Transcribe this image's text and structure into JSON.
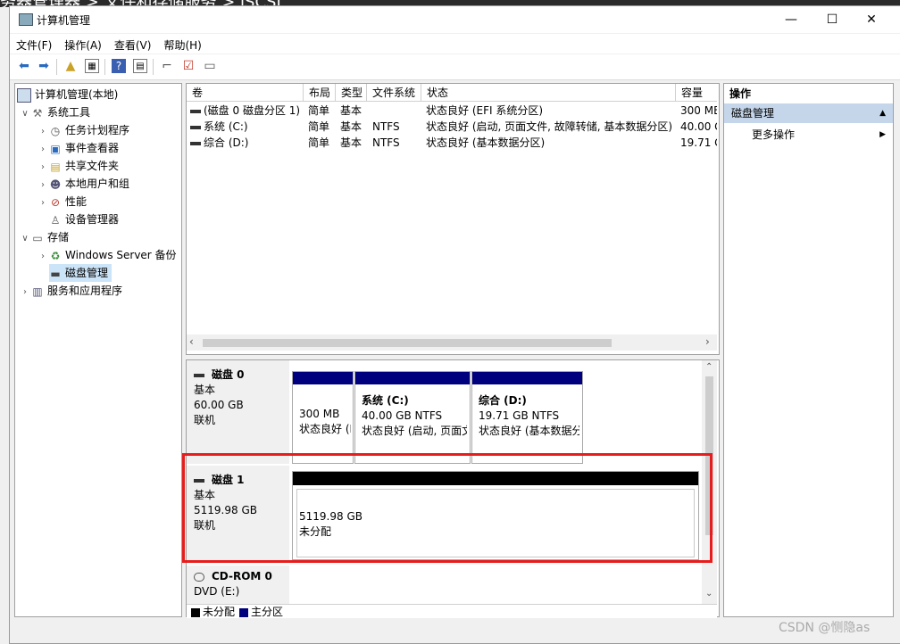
{
  "background": {
    "text": "务器管理器  >  文件和存储服务  >  iSCSI"
  },
  "window": {
    "title": "计算机管理",
    "minimize": "—",
    "maximize": "☐",
    "close": "✕"
  },
  "menu": [
    "文件(F)",
    "操作(A)",
    "查看(V)",
    "帮助(H)"
  ],
  "toolbar": {
    "icons": [
      "back-icon",
      "forward-icon",
      "up-folder-icon",
      "show-hide-tree-icon",
      "help-icon",
      "properties-icon",
      "connect-icon",
      "check-icon",
      "list-icon"
    ]
  },
  "tree": {
    "root": "计算机管理(本地)",
    "system_tools": "系统工具",
    "task_scheduler": "任务计划程序",
    "event_viewer": "事件查看器",
    "shared_folders": "共享文件夹",
    "local_users": "本地用户和组",
    "performance": "性能",
    "device_manager": "设备管理器",
    "storage": "存储",
    "windows_server_backup": "Windows Server 备份",
    "disk_management": "磁盘管理",
    "services_apps": "服务和应用程序"
  },
  "volumes": {
    "columns": [
      "卷",
      "布局",
      "类型",
      "文件系统",
      "状态",
      "容量"
    ],
    "rows": [
      {
        "vol": "(磁盘 0 磁盘分区 1)",
        "layout": "简单",
        "type": "基本",
        "fs": "",
        "status": "状态良好 (EFI 系统分区)",
        "cap": "300 MB"
      },
      {
        "vol": "系统 (C:)",
        "layout": "简单",
        "type": "基本",
        "fs": "NTFS",
        "status": "状态良好 (启动, 页面文件, 故障转储, 基本数据分区)",
        "cap": "40.00 GB"
      },
      {
        "vol": "综合 (D:)",
        "layout": "简单",
        "type": "基本",
        "fs": "NTFS",
        "status": "状态良好 (基本数据分区)",
        "cap": "19.71 GB"
      }
    ]
  },
  "disks": {
    "disk0": {
      "name": "磁盘 0",
      "type": "基本",
      "size": "60.00 GB",
      "state": "联机",
      "p1": {
        "size": "300 MB",
        "status": "状态良好 (EFI 系统分区)"
      },
      "p2": {
        "name": "系统  (C:)",
        "size": "40.00 GB NTFS",
        "status": "状态良好 (启动, 页面文件, 故障转储, 基本数据分区)"
      },
      "p3": {
        "name": "综合  (D:)",
        "size": "19.71 GB NTFS",
        "status": "状态良好 (基本数据分区)"
      }
    },
    "disk1": {
      "name": "磁盘 1",
      "type": "基本",
      "size": "5119.98 GB",
      "state": "联机",
      "p1": {
        "size": "5119.98 GB",
        "status": "未分配"
      }
    },
    "cdrom": {
      "name": "CD-ROM 0",
      "type": "DVD (E:)"
    }
  },
  "legend": {
    "unallocated": "未分配",
    "primary": "主分区"
  },
  "actions": {
    "header": "操作",
    "section": "磁盘管理",
    "more": "更多操作"
  },
  "watermark": "CSDN @恻隐as",
  "colors": {
    "primary_partition": "#00007f",
    "unallocated": "#000000",
    "highlight": "#e81c1c",
    "action_section": "#c5d6ea"
  }
}
